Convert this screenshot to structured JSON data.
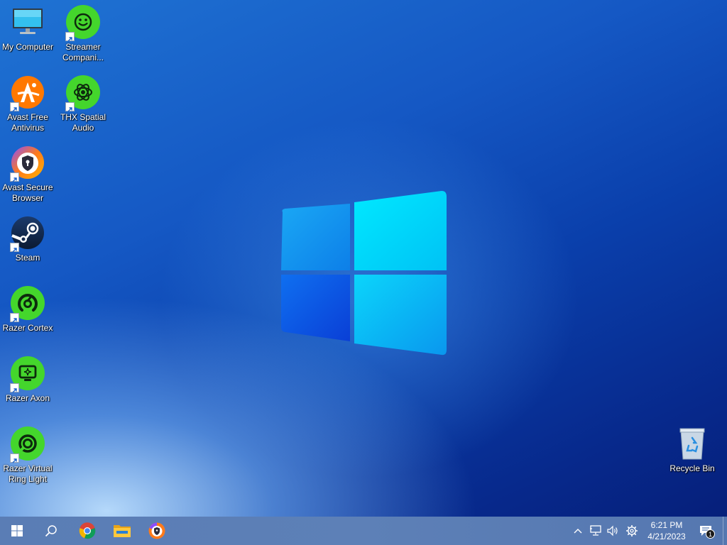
{
  "desktop": {
    "icons": [
      {
        "label": "My Computer",
        "icon": "computer-icon",
        "shortcut": false
      },
      {
        "label": "Streamer\nCompani...",
        "icon": "streamer-companion-icon",
        "shortcut": true
      },
      {
        "label": "Avast Free\nAntivirus",
        "icon": "avast-antivirus-icon",
        "shortcut": true
      },
      {
        "label": "THX Spatial\nAudio",
        "icon": "thx-spatial-audio-icon",
        "shortcut": true
      },
      {
        "label": "Avast Secure\nBrowser",
        "icon": "avast-secure-browser-icon",
        "shortcut": true
      },
      {
        "label": "Steam",
        "icon": "steam-icon",
        "shortcut": true
      },
      {
        "label": "Razer Cortex",
        "icon": "razer-cortex-icon",
        "shortcut": true
      },
      {
        "label": "Razer Axon",
        "icon": "razer-axon-icon",
        "shortcut": true
      },
      {
        "label": "Razer Virtual\nRing Light",
        "icon": "razer-ring-light-icon",
        "shortcut": true
      },
      {
        "label": "Recycle Bin",
        "icon": "recycle-bin-icon",
        "shortcut": false
      }
    ],
    "wallpaper": "windows-logo"
  },
  "taskbar": {
    "start": "windows-start-icon",
    "search": "search-icon",
    "pinned": [
      "chrome-icon",
      "file-explorer-icon",
      "avast-secure-browser-icon"
    ],
    "tray": [
      "chevron-up-icon",
      "network-icon",
      "volume-icon",
      "settings-gear-icon"
    ],
    "clock": {
      "time": "6:21 PM",
      "date": "4/21/2023"
    },
    "notifications": {
      "count": "1",
      "icon": "action-center-icon"
    }
  },
  "colors": {
    "taskbar": "#5a7db5",
    "razer_green": "#44d62c",
    "avast_orange": "#ff7800",
    "windows_logo_light": "#00e5ff",
    "windows_logo_dark": "#0a55e8"
  }
}
